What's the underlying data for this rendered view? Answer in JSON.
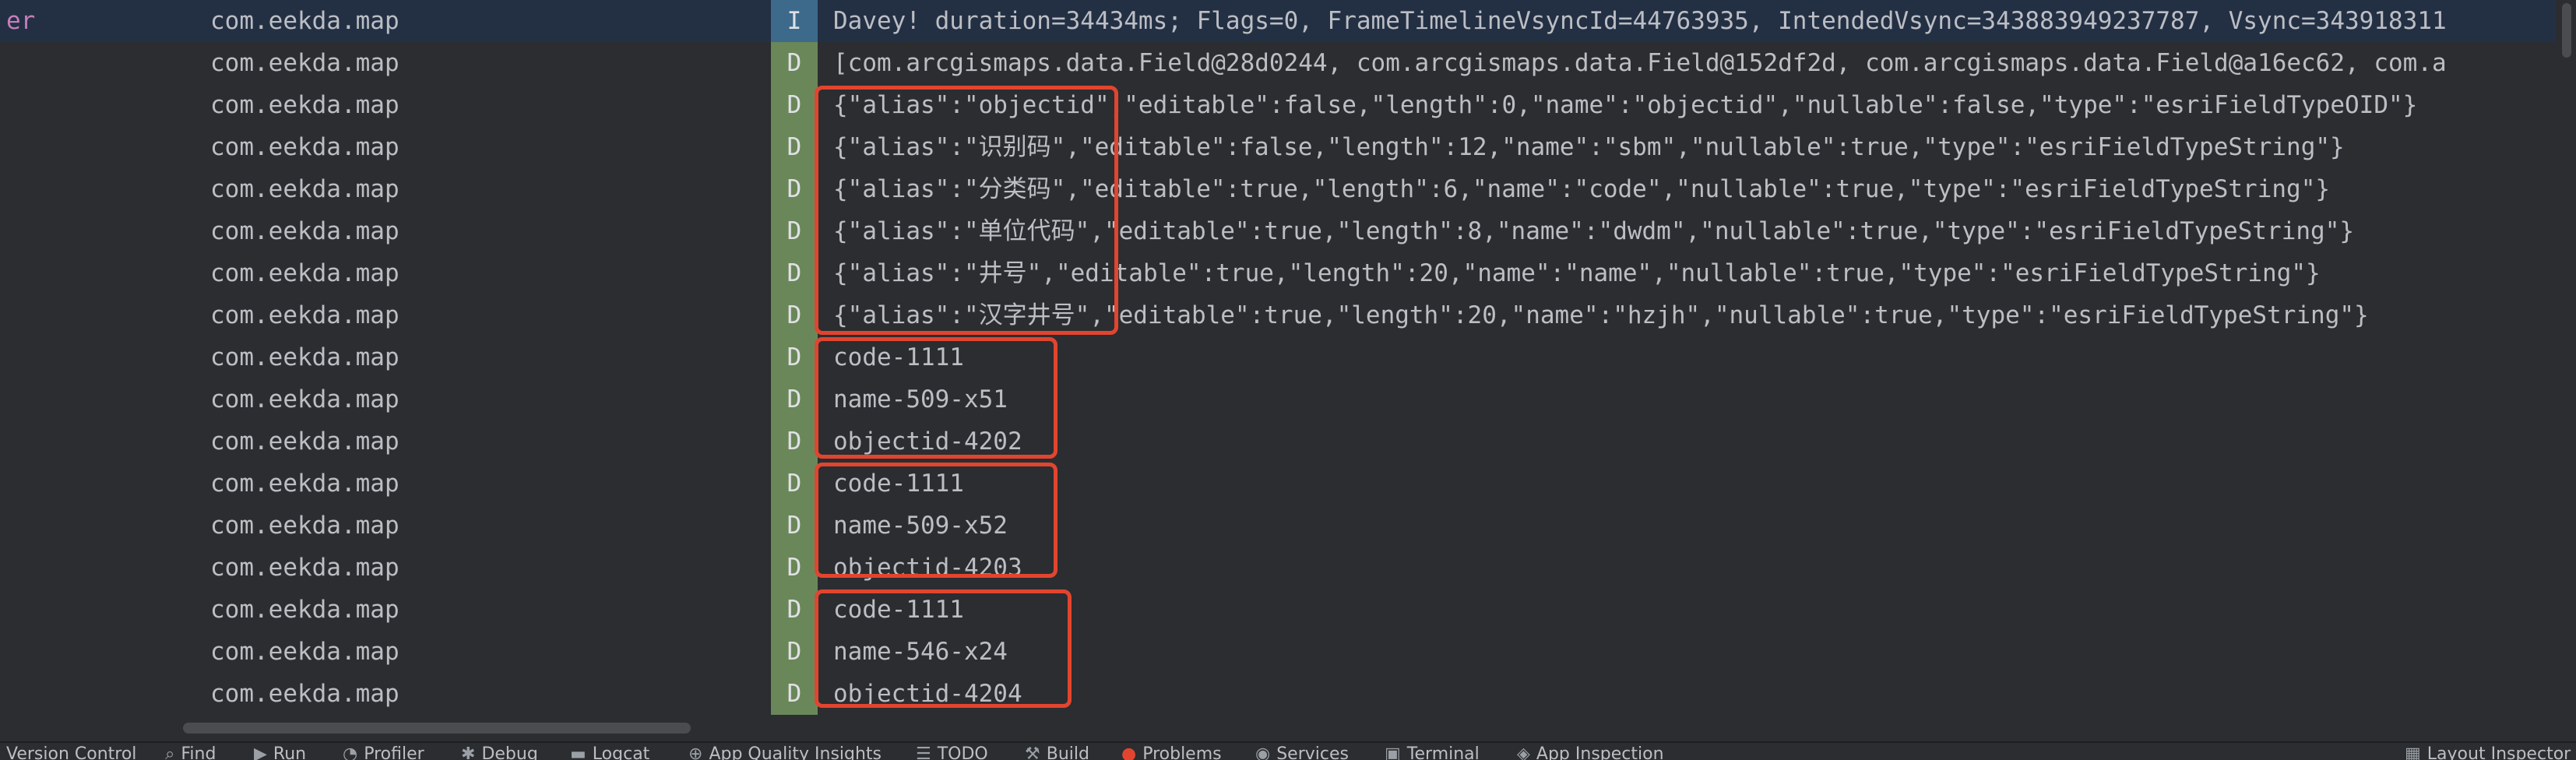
{
  "logcat": {
    "rows": [
      {
        "tag": "er",
        "package": "com.eekda.map",
        "level": "I",
        "message": "Davey! duration=34434ms; Flags=0, FrameTimelineVsyncId=44763935, IntendedVsync=343883949237787, Vsync=343918311"
      },
      {
        "tag": "",
        "package": "com.eekda.map",
        "level": "D",
        "message": "[com.arcgismaps.data.Field@28d0244, com.arcgismaps.data.Field@152df2d, com.arcgismaps.data.Field@a16ec62, com.a"
      },
      {
        "tag": "",
        "package": "com.eekda.map",
        "level": "D",
        "message": "{\"alias\":\"objectid\",\"editable\":false,\"length\":0,\"name\":\"objectid\",\"nullable\":false,\"type\":\"esriFieldTypeOID\"}"
      },
      {
        "tag": "",
        "package": "com.eekda.map",
        "level": "D",
        "message": "{\"alias\":\"识别码\",\"editable\":false,\"length\":12,\"name\":\"sbm\",\"nullable\":true,\"type\":\"esriFieldTypeString\"}"
      },
      {
        "tag": "",
        "package": "com.eekda.map",
        "level": "D",
        "message": "{\"alias\":\"分类码\",\"editable\":true,\"length\":6,\"name\":\"code\",\"nullable\":true,\"type\":\"esriFieldTypeString\"}"
      },
      {
        "tag": "",
        "package": "com.eekda.map",
        "level": "D",
        "message": "{\"alias\":\"单位代码\",\"editable\":true,\"length\":8,\"name\":\"dwdm\",\"nullable\":true,\"type\":\"esriFieldTypeString\"}"
      },
      {
        "tag": "",
        "package": "com.eekda.map",
        "level": "D",
        "message": "{\"alias\":\"井号\",\"editable\":true,\"length\":20,\"name\":\"name\",\"nullable\":true,\"type\":\"esriFieldTypeString\"}"
      },
      {
        "tag": "",
        "package": "com.eekda.map",
        "level": "D",
        "message": "{\"alias\":\"汉字井号\",\"editable\":true,\"length\":20,\"name\":\"hzjh\",\"nullable\":true,\"type\":\"esriFieldTypeString\"}"
      },
      {
        "tag": "",
        "package": "com.eekda.map",
        "level": "D",
        "message": "code-1111"
      },
      {
        "tag": "",
        "package": "com.eekda.map",
        "level": "D",
        "message": "name-509-x51"
      },
      {
        "tag": "",
        "package": "com.eekda.map",
        "level": "D",
        "message": "objectid-4202"
      },
      {
        "tag": "",
        "package": "com.eekda.map",
        "level": "D",
        "message": "code-1111"
      },
      {
        "tag": "",
        "package": "com.eekda.map",
        "level": "D",
        "message": "name-509-x52"
      },
      {
        "tag": "",
        "package": "com.eekda.map",
        "level": "D",
        "message": "objectid-4203"
      },
      {
        "tag": "",
        "package": "com.eekda.map",
        "level": "D",
        "message": "code-1111"
      },
      {
        "tag": "",
        "package": "com.eekda.map",
        "level": "D",
        "message": "name-546-x24"
      },
      {
        "tag": "",
        "package": "com.eekda.map",
        "level": "D",
        "message": "objectid-4204"
      }
    ]
  },
  "statusbar": {
    "items": [
      {
        "label": "Version Control",
        "icon": ""
      },
      {
        "label": "Find",
        "icon": "search-icon"
      },
      {
        "label": "Run",
        "icon": "play-icon"
      },
      {
        "label": "Profiler",
        "icon": "gauge-icon"
      },
      {
        "label": "Debug",
        "icon": "bug-icon"
      },
      {
        "label": "Logcat",
        "icon": "logcat-icon"
      },
      {
        "label": "App Quality Insights",
        "icon": "globe-icon"
      },
      {
        "label": "TODO",
        "icon": "list-icon"
      },
      {
        "label": "Build",
        "icon": "hammer-icon"
      },
      {
        "label": "Problems",
        "icon": "error-icon"
      },
      {
        "label": "Services",
        "icon": "services-icon"
      },
      {
        "label": "Terminal",
        "icon": "terminal-icon"
      },
      {
        "label": "App Inspection",
        "icon": "inspection-icon"
      },
      {
        "label": "Layout Inspector",
        "icon": "layout-icon"
      }
    ],
    "active": "Logcat"
  },
  "colors": {
    "background": "#2b2d30",
    "debug_level": "#6a8759",
    "info_level": "#3d6a8b",
    "annotation_box": "#e2452f",
    "tag_text": "#c77dbb"
  }
}
